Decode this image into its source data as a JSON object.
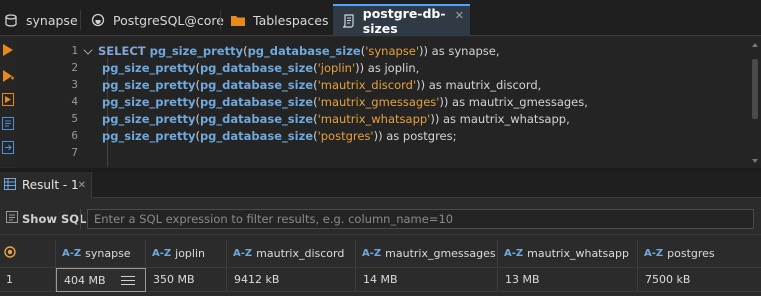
{
  "tabs": [
    {
      "label": "synapse",
      "icon": "database-icon"
    },
    {
      "label": "PostgreSQL@core",
      "icon": "plug-icon"
    },
    {
      "label": "Tablespaces",
      "icon": "folder-icon"
    },
    {
      "label": "postgre-db-sizes",
      "icon": "script-icon",
      "active": true,
      "close": "✕"
    }
  ],
  "editor": {
    "line_numbers": [
      "1",
      "2",
      "3",
      "4",
      "5",
      "6",
      "7"
    ],
    "lines": [
      [
        {
          "t": "SELECT ",
          "c": "kw"
        },
        {
          "t": "pg_size_pretty",
          "c": "fn"
        },
        {
          "t": "(",
          "c": "pl"
        },
        {
          "t": "pg_database_size",
          "c": "fn"
        },
        {
          "t": "(",
          "c": "pl"
        },
        {
          "t": "'synapse'",
          "c": "str"
        },
        {
          "t": ")) as synapse,",
          "c": "pl"
        }
      ],
      [
        {
          "t": " pg_size_pretty",
          "c": "fn"
        },
        {
          "t": "(",
          "c": "pl"
        },
        {
          "t": "pg_database_size",
          "c": "fn"
        },
        {
          "t": "(",
          "c": "pl"
        },
        {
          "t": "'joplin'",
          "c": "str"
        },
        {
          "t": ")) as joplin,",
          "c": "pl"
        }
      ],
      [
        {
          "t": " pg_size_pretty",
          "c": "fn"
        },
        {
          "t": "(",
          "c": "pl"
        },
        {
          "t": "pg_database_size",
          "c": "fn"
        },
        {
          "t": "(",
          "c": "pl"
        },
        {
          "t": "'mautrix_discord'",
          "c": "str"
        },
        {
          "t": ")) as mautrix_discord,",
          "c": "pl"
        }
      ],
      [
        {
          "t": " pg_size_pretty",
          "c": "fn"
        },
        {
          "t": "(",
          "c": "pl"
        },
        {
          "t": "pg_database_size",
          "c": "fn"
        },
        {
          "t": "(",
          "c": "pl"
        },
        {
          "t": "'mautrix_gmessages'",
          "c": "str"
        },
        {
          "t": ")) as mautrix_gmessages,",
          "c": "pl"
        }
      ],
      [
        {
          "t": " pg_size_pretty",
          "c": "fn"
        },
        {
          "t": "(",
          "c": "pl"
        },
        {
          "t": "pg_database_size",
          "c": "fn"
        },
        {
          "t": "(",
          "c": "pl"
        },
        {
          "t": "'mautrix_whatsapp'",
          "c": "str"
        },
        {
          "t": ")) as mautrix_whatsapp,",
          "c": "pl"
        }
      ],
      [
        {
          "t": " pg_size_pretty",
          "c": "fn"
        },
        {
          "t": "(",
          "c": "pl"
        },
        {
          "t": "pg_database_size",
          "c": "fn"
        },
        {
          "t": "(",
          "c": "pl"
        },
        {
          "t": "'postgres'",
          "c": "str"
        },
        {
          "t": ")) as postgres;",
          "c": "pl"
        }
      ],
      []
    ]
  },
  "results": {
    "tab_label": "Result - 1",
    "tab_close": "✕",
    "show_sql_label": "Show SQL",
    "filter_placeholder": "Enter a SQL expression to filter results, e.g. column_name=10",
    "column_type_badge": "A-Z",
    "columns": [
      "synapse",
      "joplin",
      "mautrix_discord",
      "mautrix_gmessages",
      "mautrix_whatsapp",
      "postgres"
    ],
    "rows": [
      {
        "num": "1",
        "cells": [
          "404 MB",
          "350 MB",
          "9412 kB",
          "14 MB",
          "13 MB",
          "7500 kB"
        ]
      }
    ]
  },
  "colors": {
    "accent": "#4aa3ff",
    "keyword": "#7fa6d6",
    "string": "#e6a23c",
    "toolbar_icon": "#e8891c"
  }
}
